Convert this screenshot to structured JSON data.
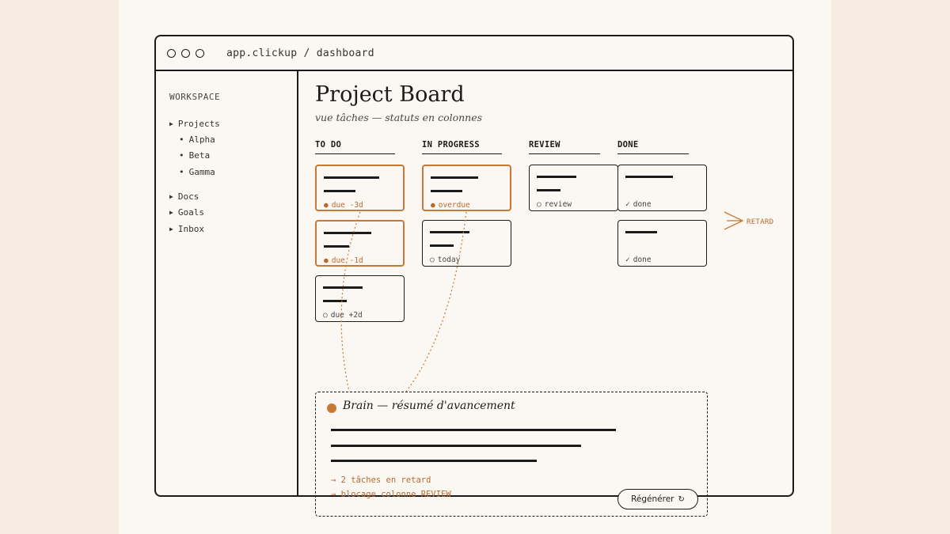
{
  "window": {
    "url": "app.clickup / dashboard"
  },
  "sidebar": {
    "workspace_label": "WORKSPACE",
    "items": [
      {
        "label": "Projects",
        "icon": "triangle-right-icon"
      },
      {
        "label": "Alpha",
        "icon": "bullet-icon"
      },
      {
        "label": "Beta",
        "icon": "bullet-icon"
      },
      {
        "label": "Gamma",
        "icon": "bullet-icon"
      },
      {
        "label": "Docs",
        "icon": "triangle-right-icon"
      },
      {
        "label": "Goals",
        "icon": "triangle-right-icon"
      },
      {
        "label": "Inbox",
        "icon": "triangle-right-icon"
      }
    ]
  },
  "board": {
    "title": "Project Board",
    "subtitle": "vue tâches — statuts en colonnes",
    "columns": [
      {
        "label": "TO DO"
      },
      {
        "label": "IN PROGRESS"
      },
      {
        "label": "REVIEW"
      },
      {
        "label": "DONE"
      }
    ],
    "cards": [
      {
        "column": "TO DO",
        "status": "due -3d",
        "marker": "●",
        "late": true
      },
      {
        "column": "TO DO",
        "status": "due -1d",
        "marker": "●",
        "late": true
      },
      {
        "column": "TO DO",
        "status": "due +2d",
        "marker": "○",
        "late": false
      },
      {
        "column": "IN PROGRESS",
        "status": "overdue",
        "marker": "●",
        "late": true
      },
      {
        "column": "IN PROGRESS",
        "status": "today",
        "marker": "○",
        "late": false
      },
      {
        "column": "REVIEW",
        "status": "review",
        "marker": "○",
        "late": false
      },
      {
        "column": "DONE",
        "status": "done",
        "marker": "✓",
        "late": false
      },
      {
        "column": "DONE",
        "status": "done",
        "marker": "✓",
        "late": false
      }
    ],
    "late_flag": "RETARD"
  },
  "brain": {
    "title": "Brain — résumé d'avancement",
    "bullets": [
      "→ 2 tâches en retard",
      "→ blocage colonne REVIEW"
    ],
    "regenerate_label": "Régénérer",
    "regenerate_icon": "↻"
  },
  "colors": {
    "accent": "#c97936",
    "ink": "#1b1b1b",
    "paper": "#fbf8f4",
    "background": "#f6ece2"
  }
}
